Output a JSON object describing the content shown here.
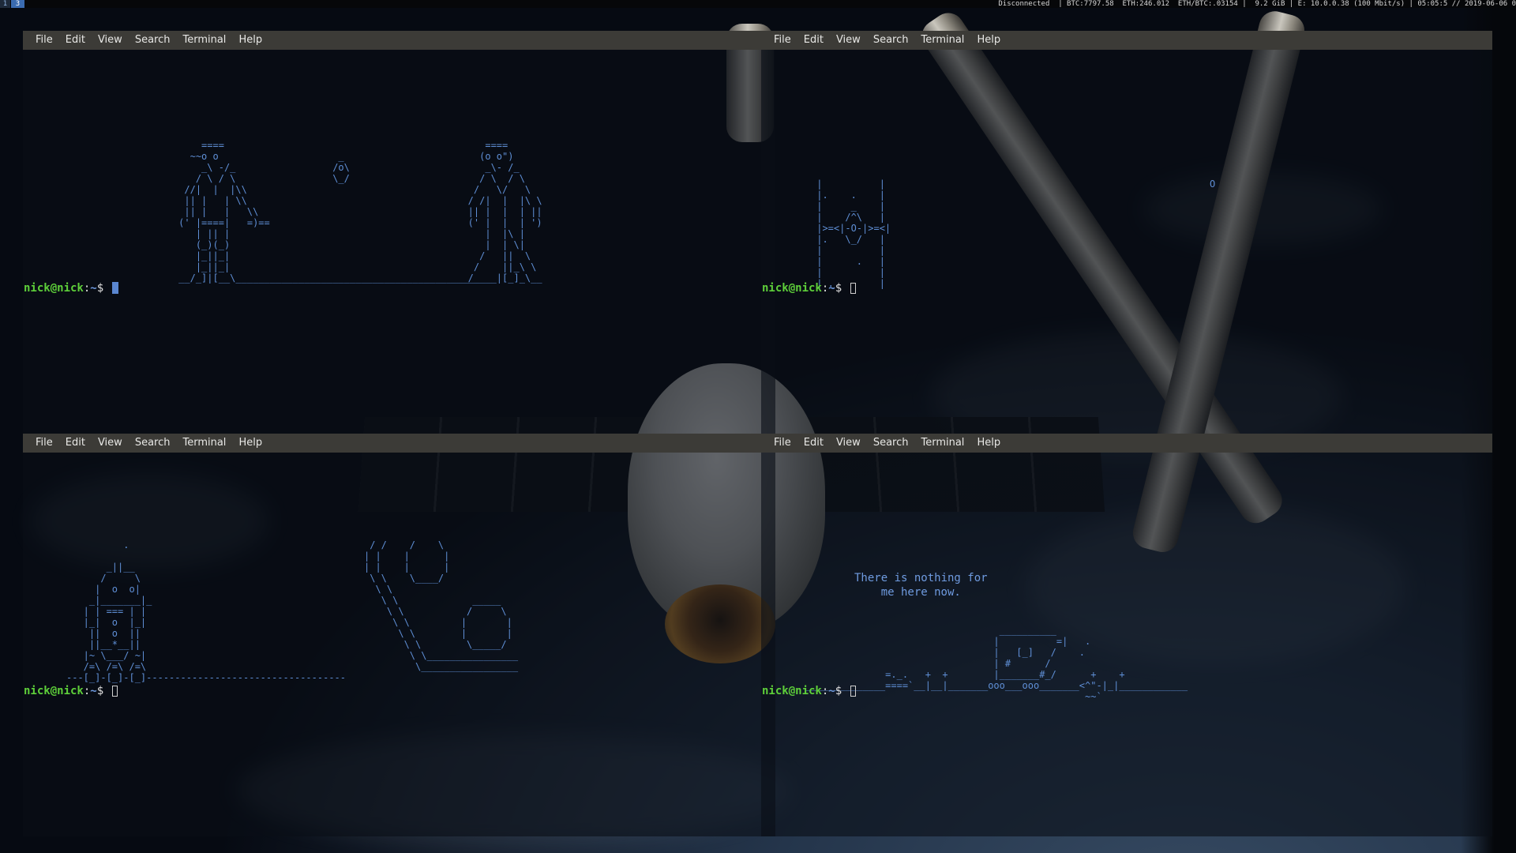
{
  "topbar": {
    "workspaces": [
      {
        "label": "1",
        "active": false
      },
      {
        "label": "3",
        "active": true
      }
    ],
    "status_text": "Disconnected  | BTC:7797.58  ETH:246.012  ETH/BTC:.03154 |  9.2 GiB | E: 10.0.0.38 (100 Mbit/s) | 05:05:5 // 2019-06-06 0"
  },
  "menu": [
    "File",
    "Edit",
    "View",
    "Search",
    "Terminal",
    "Help"
  ],
  "terminals": {
    "top_left": {
      "art": "                  ====\n                ~~o o                     _\n                  _\\ -/_                 /o\\\n                 / \\ / \\                 \\_/\n               //|  |  |\\\\\n               || |   | \\\\\n               || |   |   \\\\\n              (' |====|   =)==\n                 | || |\n                 (_)(_)\n                 |_||_|\n                 |_||_|\n              __/_]|[__\\_____________________________________________",
      "art2": "      ====\n     (o o\")\n      _\\- /_\n     / \\  / \\\n    /   \\/   \\\n   / /|  |  |\\ \\\n   || |  |  | ||\n   (' |  |  | ')\n      |  |\\ |\n      |  | \\|\n     /   ||  \\\n    /    ||_\\ \\\n___/____|[_]_\\__",
      "prompt": {
        "user": "nick@nick",
        "sep": ":",
        "path": "~",
        "dollar": "$"
      }
    },
    "top_right": {
      "art": " |          |\n |.    .    |\n |     _    |\n |    /^\\   |\n |>=<|-O-|>=<|\n |.   \\_/   |\n |          |\n |      .   |\n |          |\n | .        |",
      "star": "O",
      "prompt": {
        "user": "nick@nick",
        "sep": ":",
        "path": "~",
        "dollar": "$"
      }
    },
    "bottom_left": {
      "art": "          .\n\n       _||__\n      /     \\\n     |  o  o|\n    _|_______|_\n   | | === | |\n   |_|  o  |_|\n    ||  o  ||\n    ||__*__||\n   |~ \\___/ ~|\n   /=\\ /=\\ /=\\\n---[_]-[_]-[_]-----------------------------------",
      "art2": " / /    /    \\\n| |    |      |\n| |    |      |\n \\ \\    \\____/\n  \\ \\\n   \\ \\             _____\n    \\ \\           /     \\\n     \\ \\         |       |\n      \\ \\        |       |\n       \\ \\        \\_____/\n        \\ \\________________\n         \\_________________",
      "prompt": {
        "user": "nick@nick",
        "sep": ":",
        "path": "~",
        "dollar": "$"
      }
    },
    "bottom_right": {
      "message": "There is nothing for\nme here now.",
      "art": "                                  __________\n                                 |          =|   .\n                                 |   [_]   /    .\n                                 | #      /\n              =._.   +  +        |_______#_/      +    +\n______________====`__|__|_______ooo___ooo_______<^\"-|_|____________\n                                                 ~~`",
      "prompt": {
        "user": "nick@nick",
        "sep": ":",
        "path": "~",
        "dollar": "$"
      }
    }
  }
}
